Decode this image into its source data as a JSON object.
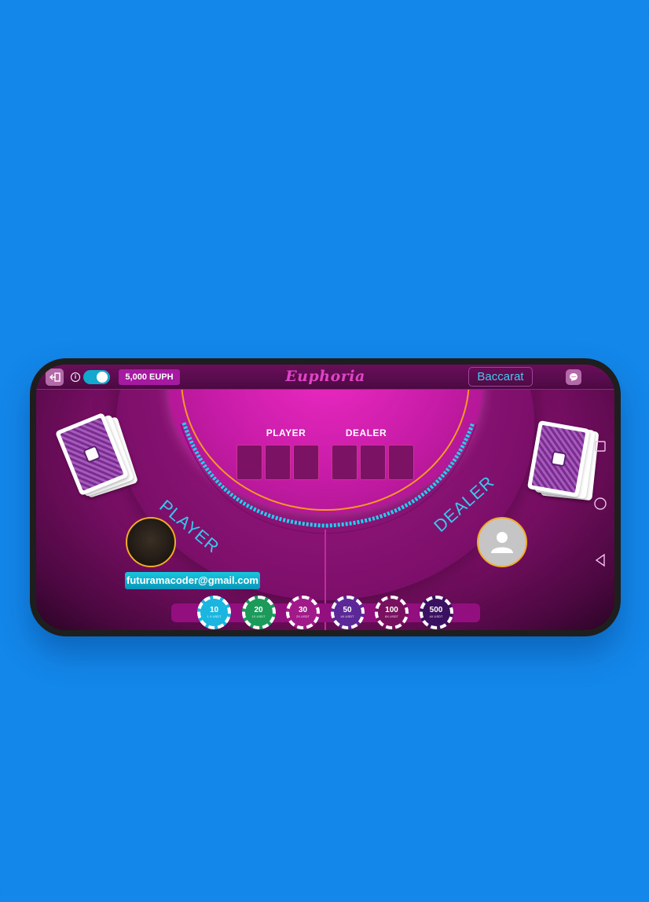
{
  "topbar": {
    "balance": "5,000 EUPH",
    "logo": "Euphoria",
    "game_name": "Baccarat",
    "toggle_on": true
  },
  "table": {
    "player_hand_label": "PLAYER",
    "dealer_hand_label": "DEALER",
    "player_side_label": "PLAYER",
    "dealer_side_label": "DEALER"
  },
  "player": {
    "email": "futuramacoder@gmail.com"
  },
  "chips": [
    {
      "value": "10",
      "sub": "1 X USDT",
      "color": "#1ab6e0"
    },
    {
      "value": "20",
      "sub": "1X USDT",
      "color": "#1c9a5a"
    },
    {
      "value": "30",
      "sub": "2X USDT",
      "color": "#a2198a"
    },
    {
      "value": "50",
      "sub": "4X USDT",
      "color": "#5c2897"
    },
    {
      "value": "100",
      "sub": "8X USDT",
      "color": "#7a1060"
    },
    {
      "value": "500",
      "sub": "4X USDT",
      "color": "#3a1060"
    }
  ],
  "icons": {
    "exit": "exit-icon",
    "info": "info-icon",
    "chat": "chat-icon",
    "square": "android-recents-icon",
    "circle": "android-home-icon",
    "triangle": "android-back-icon"
  }
}
